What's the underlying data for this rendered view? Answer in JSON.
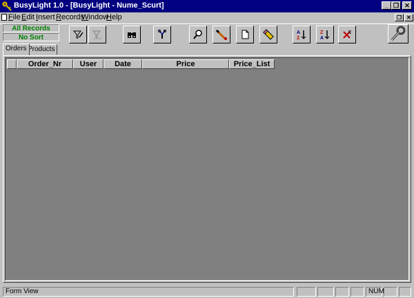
{
  "window": {
    "title": "BusyLight 1.0 - [BusyLight - Nume_Scurt]"
  },
  "menu": {
    "items": [
      {
        "pre": "",
        "ul": "F",
        "post": "ile"
      },
      {
        "pre": "",
        "ul": "E",
        "post": "dit"
      },
      {
        "pre": "",
        "ul": "I",
        "post": "nsert"
      },
      {
        "pre": "",
        "ul": "R",
        "post": "ecords"
      },
      {
        "pre": "",
        "ul": "W",
        "post": "indow"
      },
      {
        "pre": "",
        "ul": "H",
        "post": "elp"
      }
    ]
  },
  "toolbar": {
    "all_records": "All Records",
    "no_sort": "No Sort",
    "status_color": "#008000"
  },
  "tabs": [
    {
      "label": "Orders"
    },
    {
      "label": "Products"
    }
  ],
  "grid": {
    "columns": [
      "",
      "Order_Nr",
      "User",
      "Date",
      "Price",
      "Price_List"
    ]
  },
  "statusbar": {
    "mode": "Form View",
    "num": "NUM"
  },
  "colors": {
    "titlebar": "#000080",
    "grid_bg": "#808080",
    "face": "#c0c0c0"
  },
  "icons": {
    "app": "key-icon",
    "toolbar": [
      "filter-edit-icon",
      "filter-apply-icon",
      "binoculars-icon",
      "tools-icon",
      "magnifier-icon",
      "pencil-edit-icon",
      "new-document-icon",
      "eraser-icon",
      "sort-ascending-icon",
      "sort-descending-icon",
      "remove-sort-icon",
      "wrench-icon"
    ]
  }
}
